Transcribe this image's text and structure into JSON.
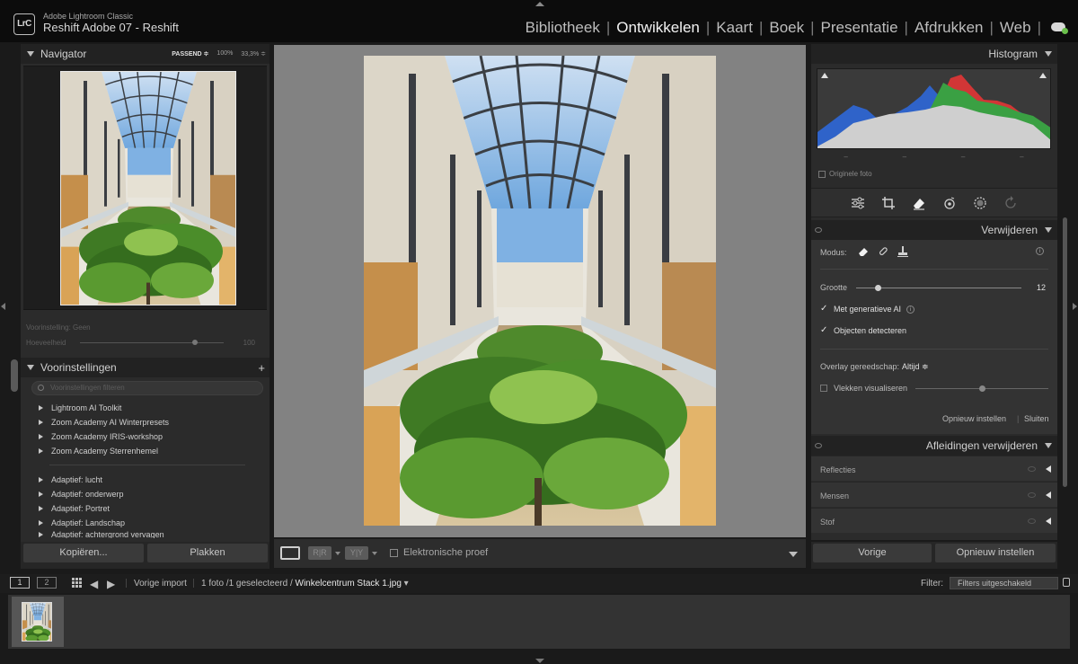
{
  "app": {
    "product_name": "Adobe Lightroom Classic",
    "catalog_name": "Reshift Adobe 07 - Reshift",
    "logo_text": "LrC"
  },
  "modules": [
    "Bibliotheek",
    "Ontwikkelen",
    "Kaart",
    "Boek",
    "Presentatie",
    "Afdrukken",
    "Web"
  ],
  "active_module": "Ontwikkelen",
  "navigator": {
    "title": "Navigator",
    "zoom_fit": "PASSEND ≑",
    "zoom_100": "100%",
    "zoom_custom": "33,3% ≑"
  },
  "preset_strip": {
    "preset_label": "Voorinstelling: Geen",
    "amount_label": "Hoeveelheid",
    "amount_value": "100",
    "amount_fraction": 0.8
  },
  "presets": {
    "title": "Voorinstellingen",
    "add_icon": "+",
    "search_placeholder": "Voorinstellingen filteren",
    "groups_a": [
      "Lightroom AI Toolkit",
      "Zoom Academy AI Winterpresets",
      "Zoom Academy IRIS-workshop",
      "Zoom Academy Sterrenhemel"
    ],
    "groups_b": [
      "Adaptief: lucht",
      "Adaptief: onderwerp",
      "Adaptief: Portret",
      "Adaptief: Landschap",
      "Adaptief: achtergrond vervagen"
    ]
  },
  "left_buttons": {
    "copy": "Kopiëren...",
    "paste": "Plakken"
  },
  "toolbar": {
    "before_after_1": "R|R",
    "before_after_2": "Y|Y",
    "soft_proof": "Elektronische proef"
  },
  "histogram": {
    "title": "Histogram",
    "dash_1": "–",
    "dash_2": "–",
    "dash_3": "–",
    "dash_4": "–",
    "original_photo": "Originele foto"
  },
  "tools": [
    "edit-sliders-icon",
    "crop-icon",
    "eraser-icon",
    "redeye-icon",
    "mask-icon",
    "refresh-icon"
  ],
  "remove": {
    "title": "Verwijderen",
    "mode_label": "Modus:",
    "size_label": "Grootte",
    "size_value": "12",
    "size_fraction": 0.13,
    "generative_ai": "Met generatieve AI",
    "detect_objects": "Objecten detecteren",
    "overlay_label": "Overlay gereedschap:",
    "overlay_value": "Altijd ≑",
    "visualize_spots": "Vlekken visualiseren",
    "visualize_fraction": 0.5,
    "reset": "Opnieuw instellen",
    "close": "Sluiten"
  },
  "distractions": {
    "title": "Afleidingen verwijderen",
    "rows": [
      "Reflecties",
      "Mensen",
      "Stof"
    ]
  },
  "right_buttons": {
    "previous": "Vorige",
    "reset": "Opnieuw instellen"
  },
  "filmbar": {
    "screen_1": "1",
    "screen_2": "2",
    "source": "Vorige import",
    "count": "1 foto /1 geselecteerd /",
    "filename": "Winkelcentrum Stack 1.jpg",
    "filter_label": "Filter:",
    "filter_value": "Filters uitgeschakeld"
  },
  "colors": {
    "hist_blue": "#2f63c9",
    "hist_green": "#3aa043",
    "hist_red": "#d23636",
    "hist_gray": "#cfcfcf"
  }
}
